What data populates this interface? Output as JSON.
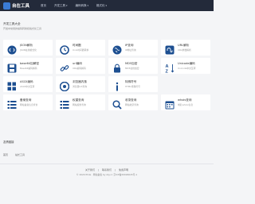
{
  "header": {
    "logo_text": "自在工具",
    "nav": [
      {
        "label": "首页",
        "caret": false
      },
      {
        "label": "开发工具",
        "caret": true
      },
      {
        "label": "编码转换",
        "caret": true
      },
      {
        "label": "格式化",
        "caret": true
      }
    ]
  },
  "intro": {
    "title": "开发工具大全",
    "subtitle": "开发中常用的编码转换和格式化工具"
  },
  "tools": [
    [
      {
        "title": "JSON解析",
        "desc": "JSON在线格式化",
        "icon": "code-icon"
      },
      {
        "title": "时间戳",
        "desc": "Unix时间戳转换",
        "icon": "time-icon"
      },
      {
        "title": "IP查询",
        "desc": "IP地址查询",
        "icon": "globe-icon"
      },
      {
        "title": "URL解析",
        "desc": "URL参数解析",
        "icon": "stumbleupon-icon"
      }
    ],
    [
      {
        "title": "base64加解密",
        "desc": "Base64编码解码",
        "icon": "save-icon"
      },
      {
        "title": "url编码",
        "desc": "URL编码解码",
        "icon": "link-icon"
      },
      {
        "title": "MD5加密",
        "desc": "MD5在线加密",
        "icon": "lock-icon"
      },
      {
        "title": "Unicode编码",
        "desc": "Unicode中文互转",
        "icon": "sort-az-icon"
      }
    ],
    [
      {
        "title": "ASCII编码",
        "desc": "ASCII中文互转",
        "icon": "grid-icon"
      },
      {
        "title": "浏览器内核",
        "desc": "浏览器UA查询",
        "icon": "chrome-icon"
      },
      {
        "title": "特殊符号",
        "desc": "HTML特殊符号",
        "icon": "info-icon"
      },
      {
        "title": "",
        "desc": "",
        "icon": ""
      }
    ],
    [
      {
        "title": "备案查询",
        "desc": "网站备案信息查询",
        "icon": "list-icon"
      },
      {
        "title": "权重查询",
        "desc": "网站权重查询",
        "icon": "list-icon"
      },
      {
        "title": "收录查询",
        "desc": "网站收录查询",
        "icon": "search-icon"
      },
      {
        "title": "whois查询",
        "desc": "域名whois信息",
        "icon": "calendar-icon"
      }
    ]
  ],
  "links_section": {
    "title": "友情链接",
    "links": [
      "首页",
      "站长工具"
    ]
  },
  "footer": {
    "links": [
      "关于我们",
      "联系我们",
      "免责声明"
    ],
    "copyright": "© 2020 Phile · 网站备案 by zzy.cc 京ICP备20026645号-1"
  },
  "colors": {
    "header_bg": "#232a3a",
    "accent": "#3a7bd5",
    "icon_color": "#1d4f91"
  }
}
